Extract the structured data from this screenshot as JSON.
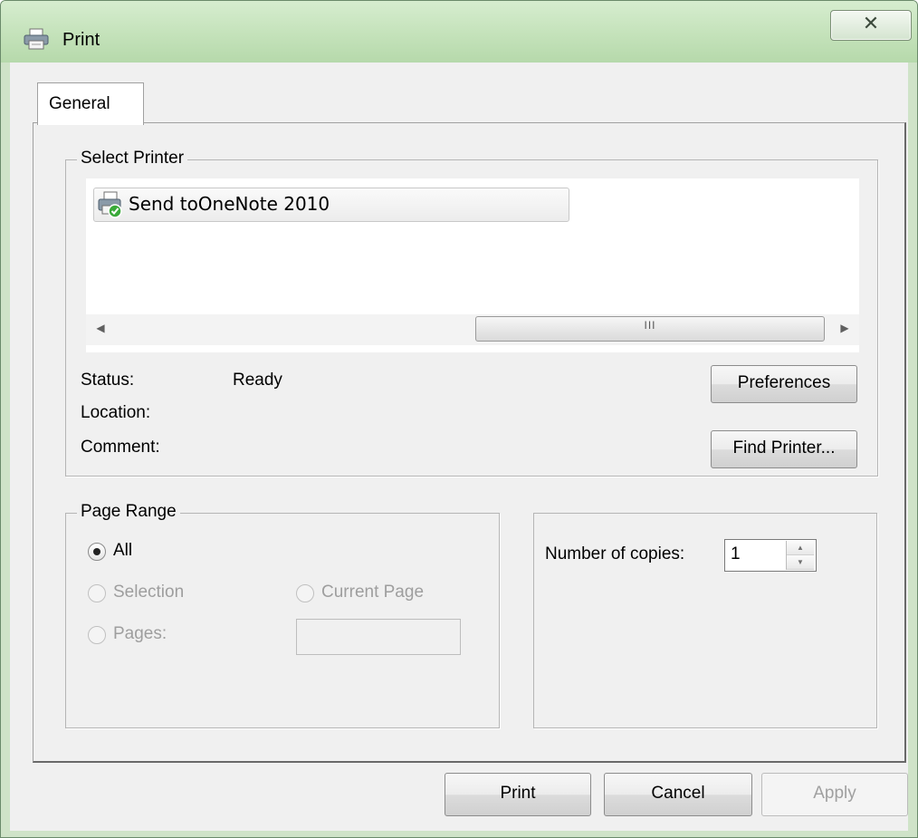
{
  "window": {
    "title": "Print",
    "close_glyph": "✕",
    "title_icon": "printer-icon"
  },
  "tabs": [
    {
      "label": "General",
      "selected": true
    }
  ],
  "select_printer": {
    "legend": "Select Printer",
    "printers": [
      {
        "name": "Send toOneNote 2010",
        "icon": "printer-default-icon",
        "selected": true
      }
    ],
    "scrollbar": {
      "left_glyph": "◀",
      "thumb_glyph": "III",
      "right_glyph": "▶"
    },
    "status_label": "Status:",
    "status_value": "Ready",
    "location_label": "Location:",
    "location_value": "",
    "comment_label": "Comment:",
    "comment_value": "",
    "preferences_button": "Preferences",
    "find_printer_button": "Find Printer..."
  },
  "page_range": {
    "legend": "Page Range",
    "options": {
      "all": "All",
      "selection": "Selection",
      "current_page": "Current Page",
      "pages": "Pages:"
    },
    "selected": "all",
    "pages_value": ""
  },
  "copies": {
    "label": "Number of copies:",
    "value": "1"
  },
  "footer": {
    "print_button": "Print",
    "cancel_button": "Cancel",
    "apply_button": "Apply"
  }
}
